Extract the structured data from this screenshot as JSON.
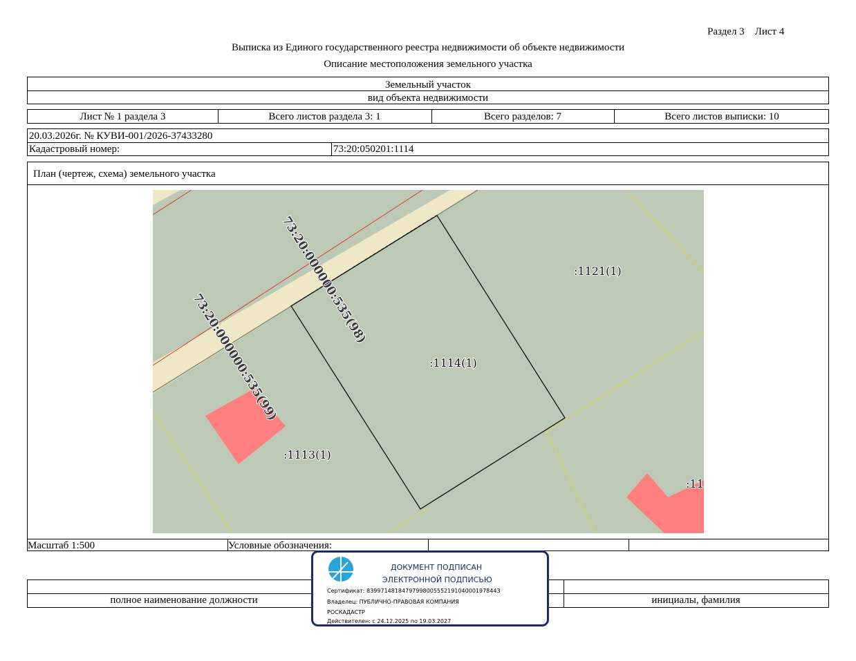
{
  "header": {
    "section_sheet": "Раздел 3    Лист 4",
    "title": "Выписка из Единого государственного реестра недвижимости об объекте недвижимости",
    "subtitle": "Описание местоположения земельного участка"
  },
  "object": {
    "type": "Земельный участок",
    "caption": "вид объекта недвижимости"
  },
  "sheet_info": {
    "sheet": "Лист № 1 раздела 3",
    "total_sheets_section": "Всего листов раздела 3: 1",
    "total_sections": "Всего разделов: 7",
    "total_sheets_extract": "Всего листов выписки: 10"
  },
  "extract": {
    "date_number": "20.03.2026г. № КУВИ-001/2026-37433280",
    "cadastral_label": "Кадастровый номер:",
    "cadastral_number": "73:20:050201:1114"
  },
  "plan": {
    "heading": "План (чертеж, схема) земельного участка",
    "labels": {
      "street_98": "73:20:000000:535(98)",
      "street_99": "73:20:000000:535(99)",
      "parcel_1114": ":1114(1)",
      "parcel_1121": ":1121(1)",
      "parcel_1113": ":1113(1)",
      "parcel_cut": ":11"
    },
    "colors": {
      "land": "#bcc9b4",
      "road": "#efe8c6",
      "building": "#ff7f7f",
      "boundary_yellow": "#d8d84a",
      "boundary_red": "#e23a3a"
    }
  },
  "footer": {
    "scale": "Масштаб 1:500",
    "legend_label": "Условные обозначения:",
    "position_caption": "полное наименование должности",
    "name_caption": "инициалы, фамилия"
  },
  "stamp": {
    "line1": "ДОКУМЕНТ ПОДПИСАН",
    "line2": "ЭЛЕКТРОННОЙ ПОДПИСЬЮ",
    "certificate": "Сертификат: 83997148184797998005552191040001978443",
    "owner_1": "Владелец: ПУБЛИЧНО-ПРАВОВАЯ КОМПАНИЯ",
    "owner_2": "РОСКАДАСТР",
    "valid": "Действителен: с 24.12.2025 по 19.03.2027",
    "logo_color": "#29a3dc",
    "border_color": "#1c2a6b"
  }
}
